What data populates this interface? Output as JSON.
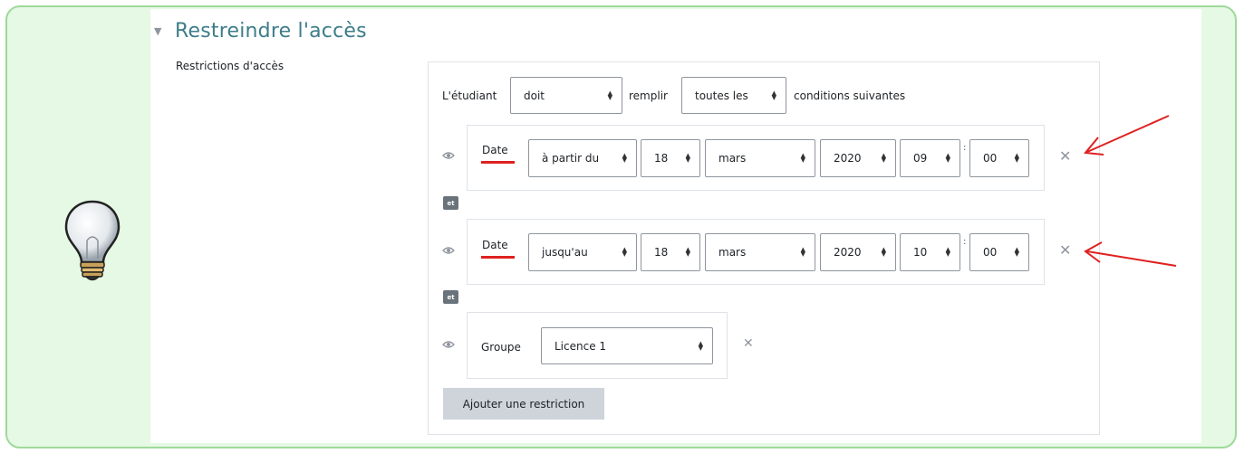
{
  "section": {
    "title": "Restreindre l'accès",
    "field_label": "Restrictions d'accès"
  },
  "header_row": {
    "prefix": "L'étudiant",
    "must_value": "doit",
    "middle": "remplir",
    "conditions_value": "toutes les",
    "suffix": "conditions suivantes"
  },
  "restrictions": [
    {
      "type_label": "Date",
      "direction": "à partir du",
      "day": "18",
      "month": "mars",
      "year": "2020",
      "hour": "09",
      "minute": "00"
    },
    {
      "type_label": "Date",
      "direction": "jusqu'au",
      "day": "18",
      "month": "mars",
      "year": "2020",
      "hour": "10",
      "minute": "00"
    },
    {
      "type_label": "Groupe",
      "group": "Licence 1"
    }
  ],
  "connector_label": "et",
  "add_button_label": "Ajouter une restriction",
  "colors": {
    "frame_border": "#9ed99a",
    "frame_bg": "#e6f9e4",
    "title": "#3d7d89",
    "annotation_red": "#e02020"
  }
}
